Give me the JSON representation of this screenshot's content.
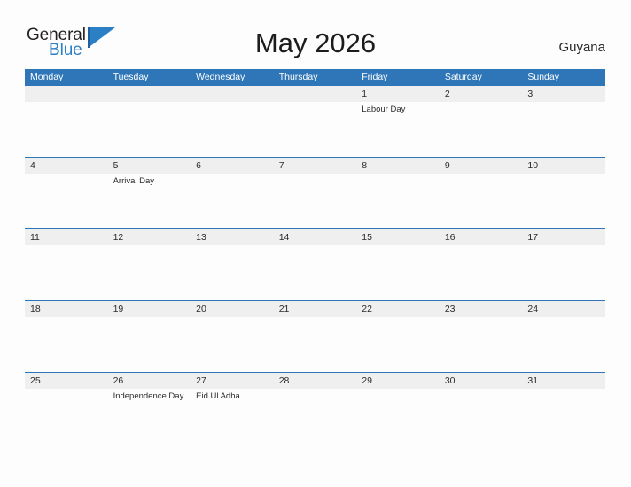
{
  "logo": {
    "text_primary": "General",
    "text_secondary": "Blue",
    "flag_icon": "blue-flag-triangle-icon",
    "color_primary": "#231f20",
    "color_secondary": "#2b7fc4"
  },
  "header": {
    "title": "May 2026",
    "country": "Guyana",
    "accent_color": "#2e76b8",
    "band_color": "#efefef"
  },
  "calendar": {
    "weekdays": [
      "Monday",
      "Tuesday",
      "Wednesday",
      "Thursday",
      "Friday",
      "Saturday",
      "Sunday"
    ],
    "weeks": [
      {
        "days": [
          {
            "date": "",
            "event": ""
          },
          {
            "date": "",
            "event": ""
          },
          {
            "date": "",
            "event": ""
          },
          {
            "date": "",
            "event": ""
          },
          {
            "date": "1",
            "event": "Labour Day"
          },
          {
            "date": "2",
            "event": ""
          },
          {
            "date": "3",
            "event": ""
          }
        ]
      },
      {
        "days": [
          {
            "date": "4",
            "event": ""
          },
          {
            "date": "5",
            "event": "Arrival Day"
          },
          {
            "date": "6",
            "event": ""
          },
          {
            "date": "7",
            "event": ""
          },
          {
            "date": "8",
            "event": ""
          },
          {
            "date": "9",
            "event": ""
          },
          {
            "date": "10",
            "event": ""
          }
        ]
      },
      {
        "days": [
          {
            "date": "11",
            "event": ""
          },
          {
            "date": "12",
            "event": ""
          },
          {
            "date": "13",
            "event": ""
          },
          {
            "date": "14",
            "event": ""
          },
          {
            "date": "15",
            "event": ""
          },
          {
            "date": "16",
            "event": ""
          },
          {
            "date": "17",
            "event": ""
          }
        ]
      },
      {
        "days": [
          {
            "date": "18",
            "event": ""
          },
          {
            "date": "19",
            "event": ""
          },
          {
            "date": "20",
            "event": ""
          },
          {
            "date": "21",
            "event": ""
          },
          {
            "date": "22",
            "event": ""
          },
          {
            "date": "23",
            "event": ""
          },
          {
            "date": "24",
            "event": ""
          }
        ]
      },
      {
        "days": [
          {
            "date": "25",
            "event": ""
          },
          {
            "date": "26",
            "event": "Independence Day"
          },
          {
            "date": "27",
            "event": "Eid Ul Adha"
          },
          {
            "date": "28",
            "event": ""
          },
          {
            "date": "29",
            "event": ""
          },
          {
            "date": "30",
            "event": ""
          },
          {
            "date": "31",
            "event": ""
          }
        ]
      }
    ]
  }
}
